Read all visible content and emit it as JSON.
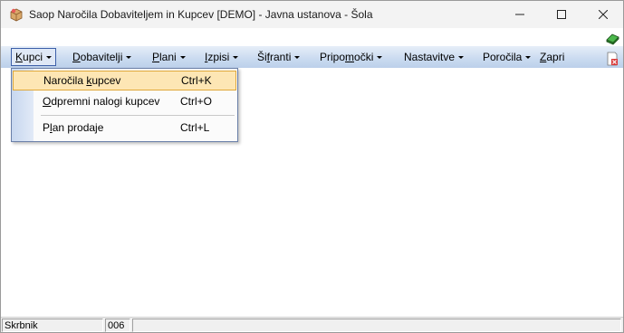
{
  "window": {
    "title": "Saop Naročila Dobaviteljem in Kupcev [DEMO] - Javna ustanova - Šola",
    "app_icon": "package-icon",
    "controls": {
      "minimize": "minimize-icon",
      "maximize": "maximize-icon",
      "close": "close-icon"
    }
  },
  "menubar": {
    "items": [
      {
        "pre": "",
        "key": "K",
        "post": "upci",
        "has_arrow": true,
        "active": true
      },
      {
        "pre": "",
        "key": "D",
        "post": "obavitelji",
        "has_arrow": true,
        "active": false
      },
      {
        "pre": "",
        "key": "P",
        "post": "lani",
        "has_arrow": true,
        "active": false
      },
      {
        "pre": "",
        "key": "I",
        "post": "zpisi",
        "has_arrow": true,
        "active": false
      },
      {
        "pre": "Ši",
        "key": "f",
        "post": "ranti",
        "has_arrow": true,
        "active": false
      },
      {
        "pre": "Pripo",
        "key": "m",
        "post": "očki",
        "has_arrow": true,
        "active": false
      },
      {
        "pre": "Nastavitve",
        "key": "",
        "post": "",
        "has_arrow": true,
        "active": false
      },
      {
        "pre": "Poročila",
        "key": "",
        "post": "",
        "has_arrow": true,
        "active": false
      },
      {
        "pre": "",
        "key": "Z",
        "post": "apri",
        "has_arrow": false,
        "active": false
      }
    ],
    "right_icons": [
      "book-icon",
      "close-document-icon"
    ]
  },
  "dropdown": {
    "items": [
      {
        "pre": "Naročila ",
        "key": "k",
        "post": "upcev",
        "shortcut": "Ctrl+K",
        "highlighted": true
      },
      {
        "pre": "",
        "key": "O",
        "post": "dpremni nalogi kupcev",
        "shortcut": "Ctrl+O",
        "highlighted": false
      },
      {
        "pre": "P",
        "key": "l",
        "post": "an prodaje",
        "shortcut": "Ctrl+L",
        "highlighted": false
      }
    ]
  },
  "statusbar": {
    "panels": [
      "Skrbnik",
      "006",
      ""
    ]
  },
  "colors": {
    "menubar_top": "#e6eef8",
    "menubar_bottom": "#bcd0ea",
    "highlight_fill": "#fde6b4",
    "highlight_border": "#e0a838"
  }
}
